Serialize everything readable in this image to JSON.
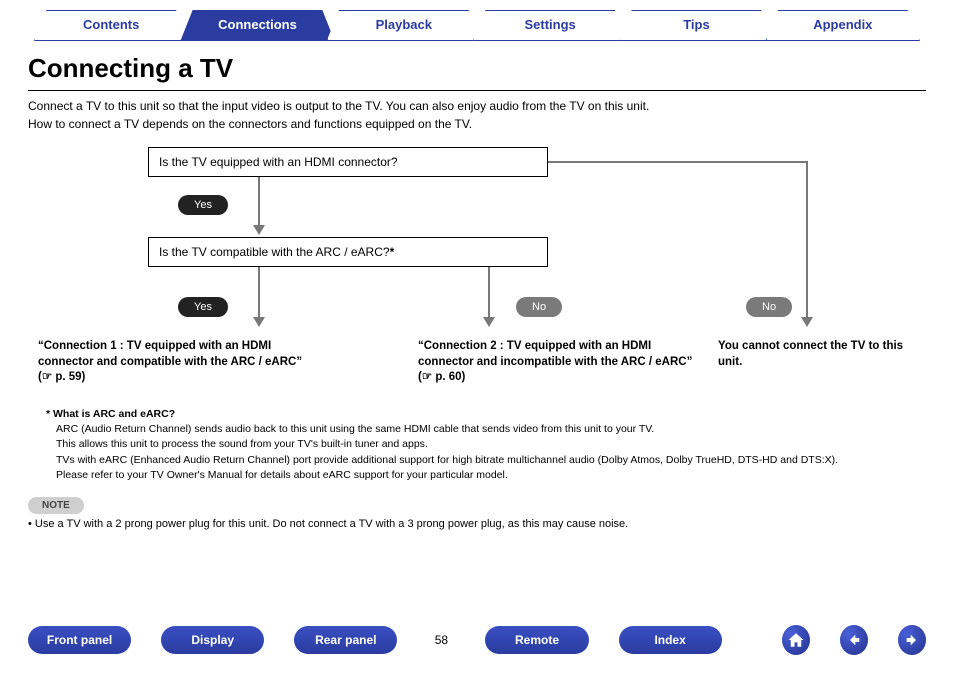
{
  "tabs": {
    "items": [
      "Contents",
      "Connections",
      "Playback",
      "Settings",
      "Tips",
      "Appendix"
    ],
    "active_index": 1
  },
  "title": "Connecting a TV",
  "intro_lines": [
    "Connect a TV to this unit so that the input video is output to the TV. You can also enjoy audio from the TV on this unit.",
    "How to connect a TV depends on the connectors and functions equipped on the TV."
  ],
  "flow": {
    "q1": "Is the TV equipped with an HDMI connector?",
    "q2_prefix": "Is the TV compatible with the ARC / eARC?",
    "q2_star": "*",
    "yes": "Yes",
    "no": "No",
    "result1": "“Connection 1 : TV equipped with an HDMI connector and compatible with the ARC / eARC” (☞ p. 59)",
    "result2": "“Connection 2 : TV equipped with an HDMI connector and incompatible with the ARC / eARC” (☞ p. 60)",
    "result3": "You cannot connect the TV to this unit."
  },
  "footnote": {
    "star": "*",
    "heading": "What is ARC and eARC?",
    "lines": [
      "ARC (Audio Return Channel) sends audio back to this unit using the same HDMI cable that sends video from this unit to your TV.",
      "This allows this unit to process the sound from your TV's built-in tuner and apps.",
      "TVs with eARC (Enhanced Audio Return Channel) port provide additional support for high bitrate multichannel audio (Dolby Atmos, Dolby TrueHD, DTS-HD and DTS:X).",
      "Please refer to your TV Owner's Manual for details about eARC support for your particular model."
    ]
  },
  "note": {
    "badge": "NOTE",
    "bullet": "• Use a TV with a 2 prong power plug for this unit. Do not connect a TV with a 3 prong power plug, as this may cause noise."
  },
  "bottom": {
    "buttons": [
      "Front panel",
      "Display",
      "Rear panel"
    ],
    "page": "58",
    "buttons2": [
      "Remote",
      "Index"
    ]
  }
}
